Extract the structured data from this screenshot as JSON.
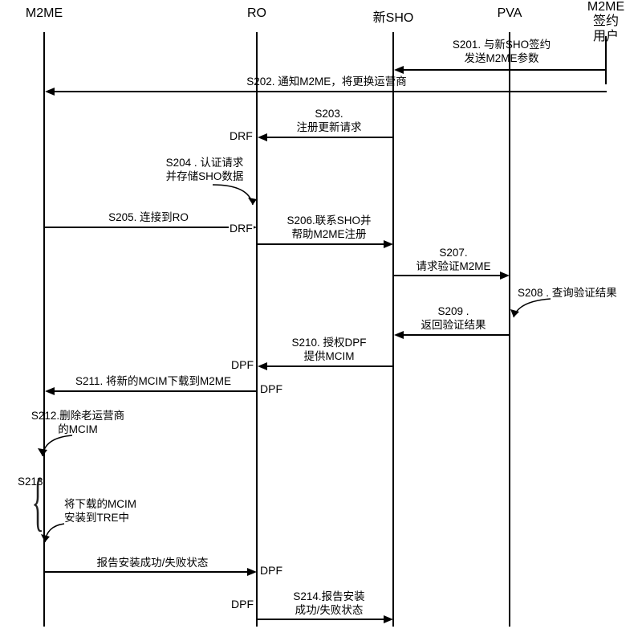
{
  "actors": {
    "m2me": "M2ME",
    "ro": "RO",
    "newSho": "新SHO",
    "pva": "PVA",
    "sub_l1": "M2ME",
    "sub_l2": "签约用户"
  },
  "positions": {
    "m2me": 55,
    "ro": 320,
    "newSho": 490,
    "pva": 635,
    "sub": 755
  },
  "labels": {
    "drf": "DRF",
    "dpf": "DPF"
  },
  "steps": {
    "s201_l1": "S201. 与新SHO签约",
    "s201_l2": "发送M2ME参数",
    "s202": "S202. 通知M2ME，将更换运营商",
    "s203_l1": "S203.",
    "s203_l2": "注册更新请求",
    "s204_l1": "S204 . 认证请求",
    "s204_l2": "并存储SHO数据",
    "s205": "S205. 连接到RO",
    "s206_l1": "S206.联系SHO并",
    "s206_l2": "帮助M2ME注册",
    "s207_l1": "S207.",
    "s207_l2": "请求验证M2ME",
    "s208": "S208 . 查询验证结果",
    "s209_l1": "S209 .",
    "s209_l2": "返回验证结果",
    "s210_l1": "S210. 授权DPF",
    "s210_l2": "提供MCIM",
    "s211": "S211. 将新的MCIM下载到M2ME",
    "s212_l1": "S212.删除老运营商",
    "s212_l2": "的MCIM",
    "s213": "S213",
    "s213_box_l1": "将下载的MCIM",
    "s213_box_l2": "安装到TRE中",
    "s213_report": "报告安装成功/失败状态",
    "s214_l1": "S214.报告安装",
    "s214_l2": "成功/失败状态"
  },
  "chart_data": {
    "type": "sequence_diagram",
    "actors": [
      "M2ME",
      "RO",
      "新SHO",
      "PVA",
      "M2ME签约用户"
    ],
    "messages": [
      {
        "id": "S201",
        "from": "M2ME签约用户",
        "to": "新SHO",
        "text": "与新SHO签约 发送M2ME参数"
      },
      {
        "id": "S202",
        "from": "M2ME签约用户",
        "to": "M2ME",
        "text": "通知M2ME，将更换运营商"
      },
      {
        "id": "S203",
        "from": "新SHO",
        "to": "RO(DRF)",
        "text": "注册更新请求"
      },
      {
        "id": "S204",
        "from": "RO",
        "to": "RO",
        "text": "认证请求并存储SHO数据",
        "self": true
      },
      {
        "id": "S205",
        "from": "M2ME",
        "to": "RO",
        "text": "连接到RO"
      },
      {
        "id": "S206",
        "from": "RO(DRF)",
        "to": "新SHO",
        "text": "联系SHO并帮助M2ME注册"
      },
      {
        "id": "S207",
        "from": "新SHO",
        "to": "PVA",
        "text": "请求验证M2ME"
      },
      {
        "id": "S208",
        "from": "PVA",
        "to": "PVA",
        "text": "查询验证结果",
        "self": true
      },
      {
        "id": "S209",
        "from": "PVA",
        "to": "新SHO",
        "text": "返回验证结果"
      },
      {
        "id": "S210",
        "from": "新SHO",
        "to": "RO(DPF)",
        "text": "授权DPF提供MCIM"
      },
      {
        "id": "S211",
        "from": "RO(DPF)",
        "to": "M2ME",
        "text": "将新的MCIM下载到M2ME"
      },
      {
        "id": "S212",
        "from": "M2ME",
        "to": "M2ME",
        "text": "删除老运营商的MCIM",
        "self": true
      },
      {
        "id": "S213",
        "from": "M2ME",
        "to": "RO(DPF)",
        "text": "将下载的MCIM安装到TRE中 / 报告安装成功/失败状态",
        "group": true
      },
      {
        "id": "S214",
        "from": "RO(DPF)",
        "to": "新SHO",
        "text": "报告安装成功/失败状态"
      }
    ]
  }
}
